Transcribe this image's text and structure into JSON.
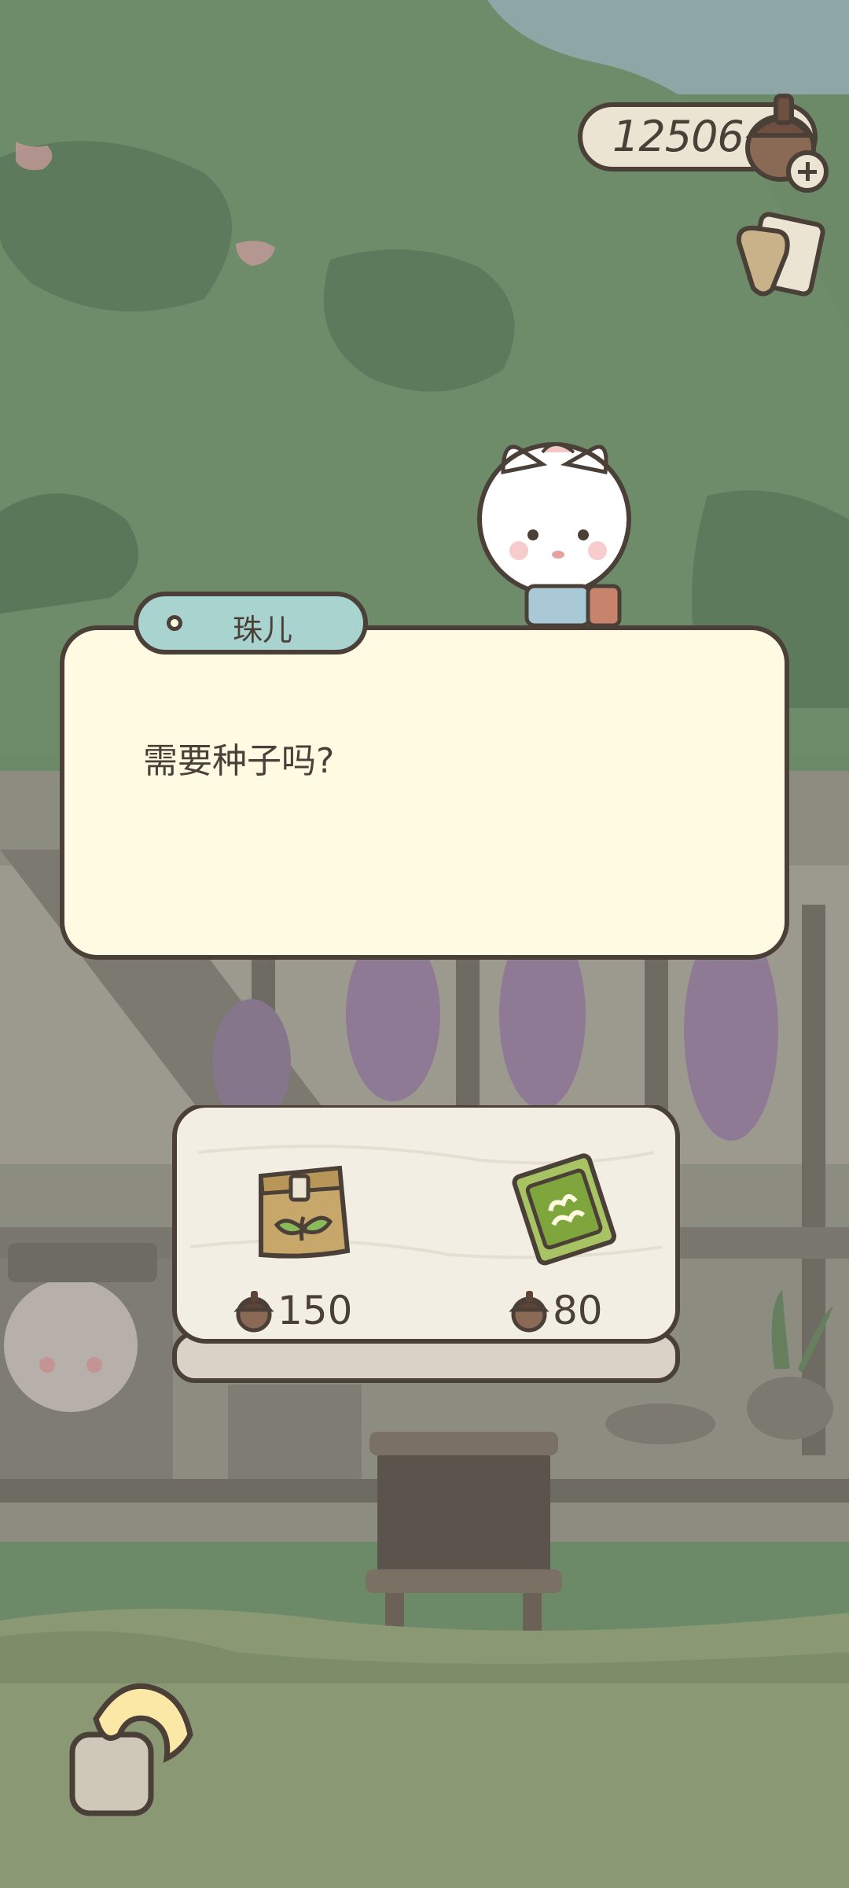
{
  "hud": {
    "acorn_count": "12506",
    "add_icon": "plus-icon",
    "side_icon": "scroll-icon"
  },
  "dialog": {
    "speaker": "珠儿",
    "text": "需要种子吗?"
  },
  "shop": {
    "items": [
      {
        "name": "seed-bag",
        "icon": "seed-bag-icon",
        "price": "150"
      },
      {
        "name": "seed-packet",
        "icon": "seed-packet-icon",
        "price": "80"
      }
    ],
    "currency_icon": "acorn-icon"
  },
  "nav": {
    "back_icon": "back-arrow-icon"
  },
  "colors": {
    "outline": "#4a4038",
    "dialog_bg": "#fffbe3",
    "name_tag_bg": "#a9d3cf",
    "board_bg": "#f2eee4"
  }
}
